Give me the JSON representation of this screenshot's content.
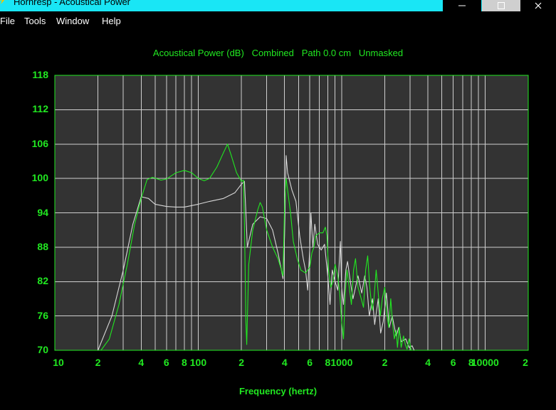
{
  "window": {
    "title": "Hornresp - Acoustical Power",
    "controls": {
      "minimize": "—",
      "maximize": "□",
      "close": "✕"
    }
  },
  "menu": [
    {
      "label": "File"
    },
    {
      "label": "Tools"
    },
    {
      "label": "Window"
    },
    {
      "label": "Help"
    }
  ],
  "colors": {
    "accent": "#21e821",
    "plot_bg": "#333333",
    "grid": "#cfcfcf",
    "series_white": "#d8d8d8",
    "titlebar": "#19e6f5"
  },
  "chart_data": {
    "type": "line",
    "title": "Acoustical Power (dB)   Combined   Path 0.0 cm   Unmasked",
    "xlabel": "Frequency (hertz)",
    "ylabel": "",
    "x_scale": "log",
    "xlim": [
      10,
      20000
    ],
    "ylim": [
      70,
      118
    ],
    "grid": true,
    "yticks": [
      "118",
      "112",
      "106",
      "100",
      "94",
      "88",
      "82",
      "76",
      "70"
    ],
    "xticks": [
      {
        "x": 10,
        "label": "10"
      },
      {
        "x": 20,
        "label": "2"
      },
      {
        "x": 40,
        "label": "4"
      },
      {
        "x": 60,
        "label": "6"
      },
      {
        "x": 80,
        "label": "8"
      },
      {
        "x": 100,
        "label": "100"
      },
      {
        "x": 200,
        "label": "2"
      },
      {
        "x": 400,
        "label": "4"
      },
      {
        "x": 600,
        "label": "6"
      },
      {
        "x": 800,
        "label": "8"
      },
      {
        "x": 1000,
        "label": "1000"
      },
      {
        "x": 2000,
        "label": "2"
      },
      {
        "x": 4000,
        "label": "4"
      },
      {
        "x": 6000,
        "label": "6"
      },
      {
        "x": 8000,
        "label": "8"
      },
      {
        "x": 10000,
        "label": "10000"
      },
      {
        "x": 20000,
        "label": "2"
      }
    ],
    "series": [
      {
        "color": "#d8d8d8",
        "points": [
          [
            20,
            70
          ],
          [
            25,
            76
          ],
          [
            30,
            84
          ],
          [
            35,
            92
          ],
          [
            40,
            96.8
          ],
          [
            45,
            96.5
          ],
          [
            50,
            95.5
          ],
          [
            60,
            95.1
          ],
          [
            70,
            95
          ],
          [
            80,
            95
          ],
          [
            100,
            95.5
          ],
          [
            120,
            96
          ],
          [
            150,
            96.5
          ],
          [
            180,
            97.5
          ],
          [
            200,
            99
          ],
          [
            210,
            99.5
          ],
          [
            215,
            94
          ],
          [
            220,
            88
          ],
          [
            240,
            92
          ],
          [
            270,
            93.3
          ],
          [
            300,
            93
          ],
          [
            330,
            91
          ],
          [
            360,
            87
          ],
          [
            380,
            84
          ],
          [
            390,
            82.5
          ],
          [
            400,
            90
          ],
          [
            410,
            104
          ],
          [
            420,
            101
          ],
          [
            450,
            98
          ],
          [
            480,
            96
          ],
          [
            510,
            90
          ],
          [
            540,
            86
          ],
          [
            560,
            84
          ],
          [
            580,
            80.5
          ],
          [
            600,
            88
          ],
          [
            610,
            94
          ],
          [
            630,
            88
          ],
          [
            650,
            92
          ],
          [
            680,
            88.5
          ],
          [
            720,
            87.5
          ],
          [
            760,
            88.5
          ],
          [
            800,
            83
          ],
          [
            830,
            78
          ],
          [
            860,
            84
          ],
          [
            900,
            82
          ],
          [
            940,
            80.5
          ],
          [
            980,
            89
          ],
          [
            1000,
            81
          ],
          [
            1030,
            78
          ],
          [
            1070,
            84
          ],
          [
            1100,
            85.5
          ],
          [
            1150,
            82
          ],
          [
            1200,
            79
          ],
          [
            1300,
            83
          ],
          [
            1380,
            80
          ],
          [
            1450,
            83
          ],
          [
            1500,
            81
          ],
          [
            1560,
            76
          ],
          [
            1640,
            79
          ],
          [
            1700,
            74.5
          ],
          [
            1800,
            79
          ],
          [
            1870,
            73
          ],
          [
            1950,
            75
          ],
          [
            2050,
            80
          ],
          [
            2150,
            74
          ],
          [
            2250,
            76
          ],
          [
            2400,
            72.5
          ],
          [
            2500,
            74
          ],
          [
            2600,
            71.5
          ],
          [
            2800,
            72
          ],
          [
            2950,
            70.5
          ],
          [
            3100,
            70.8
          ],
          [
            3200,
            70
          ]
        ]
      },
      {
        "color": "#21e821",
        "points": [
          [
            21,
            70
          ],
          [
            24,
            72
          ],
          [
            28,
            78
          ],
          [
            32,
            85
          ],
          [
            36,
            92
          ],
          [
            40,
            96.5
          ],
          [
            44,
            99.8
          ],
          [
            48,
            100.2
          ],
          [
            55,
            99.7
          ],
          [
            60,
            99.9
          ],
          [
            70,
            101
          ],
          [
            80,
            101.4
          ],
          [
            90,
            101
          ],
          [
            100,
            100
          ],
          [
            110,
            99.6
          ],
          [
            120,
            100
          ],
          [
            135,
            102
          ],
          [
            150,
            104.5
          ],
          [
            160,
            106
          ],
          [
            170,
            104
          ],
          [
            185,
            101
          ],
          [
            200,
            99.5
          ],
          [
            207,
            99.7
          ],
          [
            210,
            92
          ],
          [
            215,
            75
          ],
          [
            218,
            71
          ],
          [
            225,
            85
          ],
          [
            240,
            91
          ],
          [
            260,
            94.5
          ],
          [
            270,
            95.8
          ],
          [
            280,
            95
          ],
          [
            300,
            91
          ],
          [
            330,
            88
          ],
          [
            360,
            86
          ],
          [
            380,
            84
          ],
          [
            390,
            83
          ],
          [
            400,
            95
          ],
          [
            410,
            100
          ],
          [
            420,
            98
          ],
          [
            440,
            94
          ],
          [
            460,
            89
          ],
          [
            490,
            86
          ],
          [
            520,
            84
          ],
          [
            560,
            83.5
          ],
          [
            600,
            84.5
          ],
          [
            620,
            87
          ],
          [
            640,
            88
          ],
          [
            660,
            90
          ],
          [
            700,
            90.5
          ],
          [
            740,
            90.5
          ],
          [
            770,
            91.5
          ],
          [
            790,
            90
          ],
          [
            810,
            84
          ],
          [
            840,
            81
          ],
          [
            870,
            82
          ],
          [
            900,
            85
          ],
          [
            940,
            83
          ],
          [
            970,
            80
          ],
          [
            1000,
            75
          ],
          [
            1030,
            72
          ],
          [
            1060,
            80
          ],
          [
            1090,
            84
          ],
          [
            1130,
            81
          ],
          [
            1170,
            78
          ],
          [
            1210,
            84
          ],
          [
            1250,
            86
          ],
          [
            1300,
            81
          ],
          [
            1370,
            79
          ],
          [
            1420,
            77.5
          ],
          [
            1470,
            84
          ],
          [
            1520,
            86.5
          ],
          [
            1570,
            81
          ],
          [
            1630,
            77
          ],
          [
            1680,
            79
          ],
          [
            1740,
            84
          ],
          [
            1800,
            80
          ],
          [
            1860,
            76
          ],
          [
            1920,
            79
          ],
          [
            2000,
            81
          ],
          [
            2060,
            76.5
          ],
          [
            2130,
            74
          ],
          [
            2200,
            79
          ],
          [
            2260,
            75
          ],
          [
            2330,
            72
          ],
          [
            2400,
            73.5
          ],
          [
            2450,
            70.5
          ],
          [
            2520,
            74
          ],
          [
            2600,
            70.5
          ],
          [
            2700,
            72.5
          ],
          [
            2780,
            71
          ],
          [
            2860,
            70.2
          ],
          [
            2950,
            72
          ],
          [
            3050,
            70
          ]
        ]
      }
    ]
  }
}
